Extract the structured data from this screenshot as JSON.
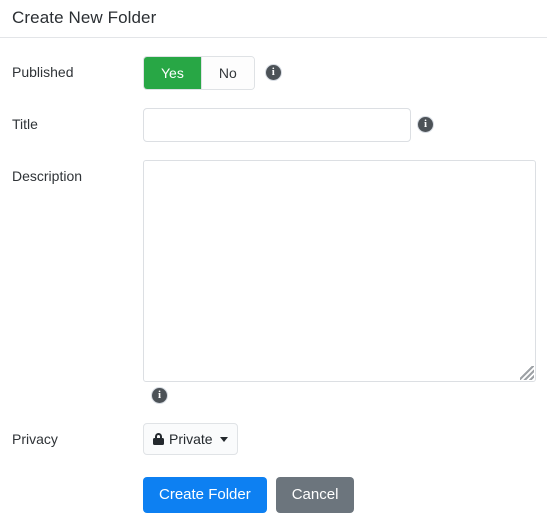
{
  "dialog": {
    "title": "Create New Folder"
  },
  "fields": {
    "published": {
      "label": "Published",
      "options": [
        {
          "label": "Yes",
          "active": true
        },
        {
          "label": "No",
          "active": false
        }
      ],
      "help_icon": "info-icon"
    },
    "title": {
      "label": "Title",
      "value": "",
      "placeholder": "",
      "help_icon": "info-icon"
    },
    "description": {
      "label": "Description",
      "value": "",
      "placeholder": "",
      "help_icon": "info-icon",
      "resize_handle": "resize-grip-icon"
    },
    "privacy": {
      "label": "Privacy",
      "selected": "Private",
      "icon": "lock-icon",
      "caret": "chevron-down-icon"
    }
  },
  "actions": {
    "submit_label": "Create Folder",
    "cancel_label": "Cancel"
  },
  "colors": {
    "accent_green": "#28a745",
    "primary_blue": "#0d80f2",
    "secondary_gray": "#6c757d",
    "border": "#dcdfe3",
    "text": "#2f3337"
  }
}
